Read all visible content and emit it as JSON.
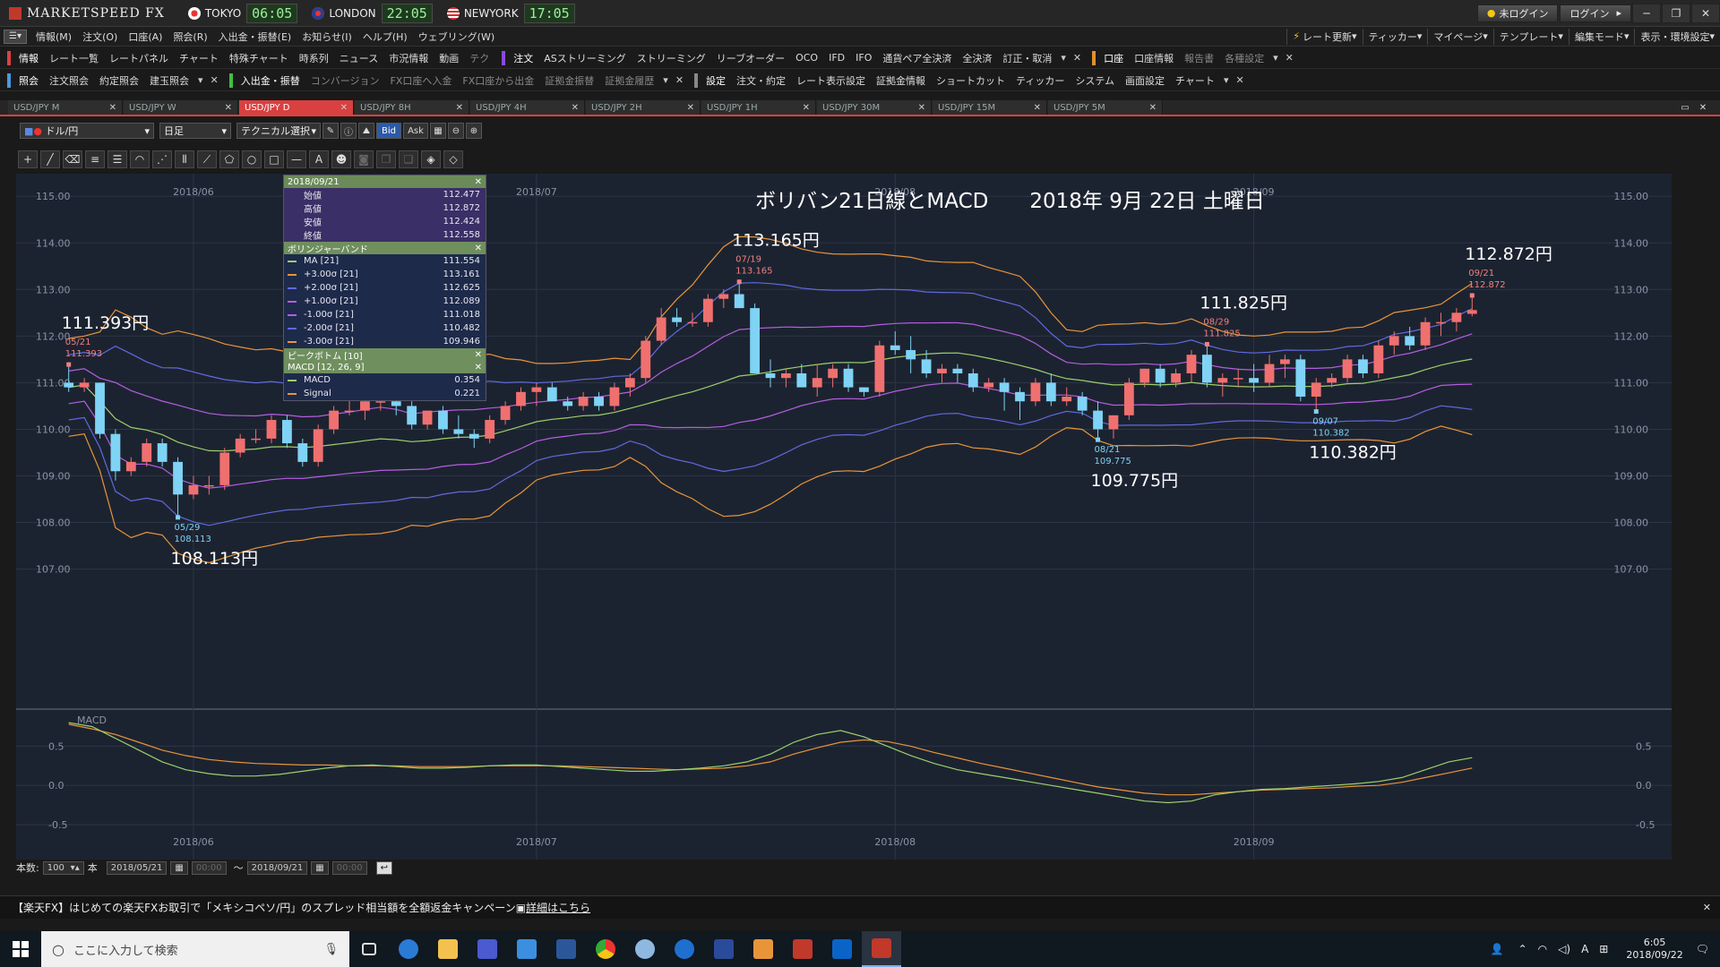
{
  "titlebar": {
    "app_title": "MARKETSPEED FX",
    "clocks": [
      {
        "label": "TOKYO",
        "time": "06:05"
      },
      {
        "label": "LONDON",
        "time": "22:05"
      },
      {
        "label": "NEWYORK",
        "time": "17:05"
      }
    ],
    "login_status": "未ログイン",
    "login_button": "ログイン"
  },
  "menubar": {
    "items": [
      "情報(M)",
      "注文(O)",
      "口座(A)",
      "照会(R)",
      "入出金・振替(E)",
      "お知らせ(I)",
      "ヘルプ(H)",
      "ウェブリング(W)"
    ],
    "right_items": [
      "レート更新",
      "ティッカー",
      "マイページ",
      "テンプレート",
      "編集モード",
      "表示・環境設定"
    ]
  },
  "tools1": {
    "group1": [
      "情報",
      "レート一覧",
      "レートパネル",
      "チャート",
      "特殊チャート",
      "時系列",
      "ニュース",
      "市況情報",
      "動画",
      "テク"
    ],
    "group2": [
      "注文",
      "ASストリーミング",
      "ストリーミング",
      "リーブオーダー",
      "OCO",
      "IFD",
      "IFO",
      "通貨ペア全決済",
      "全決済",
      "訂正・取消"
    ],
    "group3": [
      "口座",
      "口座情報",
      "報告書",
      "各種設定"
    ]
  },
  "tools2": {
    "group1": [
      "照会",
      "注文照会",
      "約定照会",
      "建玉照会"
    ],
    "group2": [
      "入出金・振替",
      "コンバージョン",
      "FX口座へ入金",
      "FX口座から出金",
      "証拠金振替",
      "証拠金履歴"
    ],
    "group3": [
      "設定",
      "注文・約定",
      "レート表示設定",
      "証拠金情報",
      "ショートカット",
      "ティッカー",
      "システム",
      "画面設定",
      "チャート"
    ]
  },
  "tabs": [
    "USD/JPY M",
    "USD/JPY W",
    "USD/JPY D",
    "USD/JPY 8H",
    "USD/JPY 4H",
    "USD/JPY 2H",
    "USD/JPY 1H",
    "USD/JPY 30M",
    "USD/JPY 15M",
    "USD/JPY 5M"
  ],
  "active_tab": 2,
  "charttools": {
    "pair": "ドル/円",
    "period": "日足",
    "technical": "テクニカル選択",
    "bid": "Bid",
    "ask": "Ask"
  },
  "infopanel": {
    "date": "2018/09/21",
    "ohlc": [
      {
        "label": "始値",
        "value": "112.477"
      },
      {
        "label": "高値",
        "value": "112.872"
      },
      {
        "label": "安値",
        "value": "112.424"
      },
      {
        "label": "終値",
        "value": "112.558"
      }
    ],
    "bb_title": "ボリンジャーバンド",
    "bb": [
      {
        "label": "MA [21]",
        "value": "111.554",
        "color": "#9bd06c"
      },
      {
        "label": "+3.00σ [21]",
        "value": "113.161",
        "color": "#e8953a"
      },
      {
        "label": "+2.00σ [21]",
        "value": "112.625",
        "color": "#5f6ae0"
      },
      {
        "label": "+1.00σ [21]",
        "value": "112.089",
        "color": "#b45ee0"
      },
      {
        "label": "-1.00σ [21]",
        "value": "111.018",
        "color": "#b45ee0"
      },
      {
        "label": "-2.00σ [21]",
        "value": "110.482",
        "color": "#5f6ae0"
      },
      {
        "label": "-3.00σ [21]",
        "value": "109.946",
        "color": "#e8953a"
      }
    ],
    "peak_title": "ピークボトム [10]",
    "macd_title": "MACD [12, 26, 9]",
    "macd": [
      {
        "label": "MACD",
        "value": "0.354",
        "color": "#9bd06c"
      },
      {
        "label": "Signal",
        "value": "0.221",
        "color": "#e8953a"
      }
    ]
  },
  "chart_data": {
    "type": "candlestick",
    "title": "ボリバン21日線とMACD　　2018年 9月 22日 土曜日",
    "y_ticks": [
      "115.00",
      "114.00",
      "113.00",
      "112.00",
      "111.00",
      "110.00",
      "109.00",
      "108.00",
      "107.00"
    ],
    "ylim": [
      106.8,
      115.1
    ],
    "x_month_labels": [
      "2018/06",
      "2018/07",
      "2018/08",
      "2018/09"
    ],
    "colors": {
      "up": "#f07070",
      "down": "#7fd3f5",
      "ma": "#9bd06c",
      "s3": "#e8953a",
      "s2": "#5f6ae0",
      "s1": "#b45ee0",
      "macd": "#9bd06c",
      "signal": "#e8953a"
    },
    "candles": [
      [
        111.0,
        111.39,
        110.8,
        110.9
      ],
      [
        110.9,
        111.1,
        110.8,
        111.0
      ],
      [
        111.0,
        111.0,
        109.8,
        109.9
      ],
      [
        109.9,
        110.0,
        108.9,
        109.1
      ],
      [
        109.1,
        109.4,
        109.0,
        109.3
      ],
      [
        109.3,
        109.8,
        109.2,
        109.7
      ],
      [
        109.7,
        109.8,
        109.2,
        109.3
      ],
      [
        109.3,
        109.4,
        108.11,
        108.6
      ],
      [
        108.6,
        109.0,
        108.5,
        108.8
      ],
      [
        108.8,
        109.0,
        108.6,
        108.8
      ],
      [
        108.8,
        109.6,
        108.7,
        109.5
      ],
      [
        109.5,
        109.9,
        109.4,
        109.8
      ],
      [
        109.8,
        110.0,
        109.7,
        109.8
      ],
      [
        109.8,
        110.3,
        109.7,
        110.2
      ],
      [
        110.2,
        110.3,
        109.6,
        109.7
      ],
      [
        109.7,
        109.8,
        109.2,
        109.3
      ],
      [
        109.3,
        110.1,
        109.2,
        110.0
      ],
      [
        110.0,
        110.5,
        109.9,
        110.4
      ],
      [
        110.4,
        110.9,
        110.3,
        110.4
      ],
      [
        110.4,
        110.7,
        110.2,
        110.6
      ],
      [
        110.6,
        110.7,
        110.4,
        110.6
      ],
      [
        110.6,
        110.9,
        110.3,
        110.5
      ],
      [
        110.5,
        110.6,
        110.0,
        110.1
      ],
      [
        110.1,
        110.4,
        110.0,
        110.4
      ],
      [
        110.4,
        110.5,
        109.9,
        110.0
      ],
      [
        110.0,
        110.3,
        109.8,
        109.9
      ],
      [
        109.9,
        110.0,
        109.6,
        109.8
      ],
      [
        109.8,
        110.3,
        109.7,
        110.2
      ],
      [
        110.2,
        110.6,
        110.1,
        110.5
      ],
      [
        110.5,
        110.9,
        110.4,
        110.8
      ],
      [
        110.8,
        111.0,
        110.5,
        110.9
      ],
      [
        110.9,
        111.0,
        110.6,
        110.6
      ],
      [
        110.6,
        110.7,
        110.4,
        110.5
      ],
      [
        110.5,
        110.8,
        110.4,
        110.7
      ],
      [
        110.7,
        110.8,
        110.4,
        110.5
      ],
      [
        110.5,
        111.0,
        110.4,
        110.9
      ],
      [
        110.9,
        111.2,
        110.7,
        111.1
      ],
      [
        111.1,
        112.0,
        111.0,
        111.9
      ],
      [
        111.9,
        112.6,
        111.8,
        112.4
      ],
      [
        112.4,
        112.6,
        112.2,
        112.3
      ],
      [
        112.3,
        112.5,
        112.2,
        112.3
      ],
      [
        112.3,
        112.9,
        112.2,
        112.8
      ],
      [
        112.8,
        113.0,
        112.6,
        112.9
      ],
      [
        112.9,
        113.165,
        112.6,
        112.6
      ],
      [
        112.6,
        112.7,
        111.2,
        111.2
      ],
      [
        111.2,
        111.5,
        110.9,
        111.1
      ],
      [
        111.1,
        111.3,
        110.9,
        111.2
      ],
      [
        111.2,
        111.4,
        110.9,
        110.9
      ],
      [
        110.9,
        111.4,
        110.7,
        111.1
      ],
      [
        111.1,
        111.4,
        110.9,
        111.3
      ],
      [
        111.3,
        111.4,
        110.8,
        110.9
      ],
      [
        110.9,
        110.9,
        110.7,
        110.8
      ],
      [
        110.8,
        111.9,
        110.7,
        111.8
      ],
      [
        111.8,
        112.1,
        111.6,
        111.7
      ],
      [
        111.7,
        112.0,
        111.2,
        111.5
      ],
      [
        111.5,
        111.7,
        111.1,
        111.2
      ],
      [
        111.2,
        111.4,
        111.0,
        111.3
      ],
      [
        111.3,
        111.4,
        111.0,
        111.2
      ],
      [
        111.2,
        111.3,
        110.8,
        110.9
      ],
      [
        110.9,
        111.1,
        110.8,
        111.0
      ],
      [
        111.0,
        111.1,
        110.4,
        110.8
      ],
      [
        110.8,
        110.9,
        110.2,
        110.6
      ],
      [
        110.6,
        111.1,
        110.5,
        111.0
      ],
      [
        111.0,
        111.2,
        110.5,
        110.6
      ],
      [
        110.6,
        110.9,
        110.5,
        110.7
      ],
      [
        110.7,
        110.8,
        110.3,
        110.4
      ],
      [
        110.4,
        110.6,
        109.775,
        110.0
      ],
      [
        110.0,
        110.3,
        109.8,
        110.3
      ],
      [
        110.3,
        111.1,
        110.2,
        111.0
      ],
      [
        111.0,
        111.3,
        110.9,
        111.3
      ],
      [
        111.3,
        111.4,
        110.9,
        111.0
      ],
      [
        111.0,
        111.3,
        110.9,
        111.2
      ],
      [
        111.2,
        111.7,
        111.0,
        111.6
      ],
      [
        111.6,
        111.825,
        110.9,
        111.0
      ],
      [
        111.0,
        111.2,
        110.7,
        111.1
      ],
      [
        111.1,
        111.3,
        110.9,
        111.1
      ],
      [
        111.1,
        111.4,
        110.8,
        111.0
      ],
      [
        111.0,
        111.6,
        110.9,
        111.4
      ],
      [
        111.4,
        111.6,
        111.1,
        111.5
      ],
      [
        111.5,
        111.6,
        110.6,
        110.7
      ],
      [
        110.7,
        111.1,
        110.382,
        111.0
      ],
      [
        111.0,
        111.2,
        110.9,
        111.1
      ],
      [
        111.1,
        111.6,
        111.0,
        111.5
      ],
      [
        111.5,
        111.6,
        111.1,
        111.2
      ],
      [
        111.2,
        111.9,
        111.1,
        111.8
      ],
      [
        111.8,
        112.1,
        111.6,
        112.0
      ],
      [
        112.0,
        112.2,
        111.7,
        111.8
      ],
      [
        111.8,
        112.4,
        111.7,
        112.3
      ],
      [
        112.3,
        112.5,
        112.0,
        112.3
      ],
      [
        112.3,
        112.6,
        112.1,
        112.5
      ],
      [
        112.477,
        112.872,
        112.424,
        112.558
      ]
    ],
    "annotations": [
      {
        "idx": 0,
        "date": "05/21",
        "price": "111.393",
        "big": "111.393円",
        "pos": "high"
      },
      {
        "idx": 7,
        "date": "05/29",
        "price": "108.113",
        "big": "108.113円",
        "pos": "low"
      },
      {
        "idx": 43,
        "date": "07/19",
        "price": "113.165",
        "big": "113.165円",
        "pos": "high"
      },
      {
        "idx": 66,
        "date": "08/21",
        "price": "109.775",
        "big": "109.775円",
        "pos": "low"
      },
      {
        "idx": 73,
        "date": "08/29",
        "price": "111.825",
        "big": "111.825円",
        "pos": "high"
      },
      {
        "idx": 80,
        "date": "09/07",
        "price": "110.382",
        "big": "110.382円",
        "pos": "low"
      },
      {
        "idx": 90,
        "date": "09/21",
        "price": "112.872",
        "big": "112.872円",
        "pos": "high"
      }
    ],
    "macd_panel": {
      "label": "MACD",
      "y_ticks": [
        "0.5",
        "0.0",
        "-0.5"
      ],
      "ylim": [
        -0.9,
        0.95
      ],
      "macd_points": [
        0.8,
        0.75,
        0.6,
        0.45,
        0.3,
        0.2,
        0.15,
        0.12,
        0.12,
        0.14,
        0.18,
        0.22,
        0.25,
        0.26,
        0.24,
        0.22,
        0.22,
        0.23,
        0.25,
        0.26,
        0.26,
        0.24,
        0.22,
        0.2,
        0.18,
        0.18,
        0.2,
        0.22,
        0.25,
        0.3,
        0.4,
        0.55,
        0.65,
        0.7,
        0.62,
        0.5,
        0.38,
        0.28,
        0.2,
        0.15,
        0.1,
        0.05,
        0.0,
        -0.05,
        -0.1,
        -0.15,
        -0.2,
        -0.22,
        -0.2,
        -0.12,
        -0.08,
        -0.05,
        -0.04,
        -0.02,
        0.0,
        0.02,
        0.05,
        0.1,
        0.2,
        0.3,
        0.354
      ],
      "signal_points": [
        0.78,
        0.72,
        0.65,
        0.55,
        0.45,
        0.38,
        0.33,
        0.3,
        0.28,
        0.27,
        0.26,
        0.26,
        0.25,
        0.25,
        0.25,
        0.24,
        0.24,
        0.24,
        0.25,
        0.25,
        0.25,
        0.25,
        0.24,
        0.23,
        0.22,
        0.21,
        0.2,
        0.21,
        0.22,
        0.25,
        0.3,
        0.4,
        0.48,
        0.55,
        0.58,
        0.56,
        0.5,
        0.42,
        0.35,
        0.28,
        0.22,
        0.16,
        0.1,
        0.04,
        -0.02,
        -0.06,
        -0.1,
        -0.12,
        -0.12,
        -0.1,
        -0.08,
        -0.06,
        -0.05,
        -0.04,
        -0.03,
        -0.01,
        0.0,
        0.04,
        0.1,
        0.16,
        0.221
      ]
    }
  },
  "bottombar": {
    "count_label": "本数:",
    "count": "100",
    "unit": "本",
    "from_date": "2018/05/21",
    "from_time": "00:00",
    "tilde": "〜",
    "to_date": "2018/09/21",
    "to_time": "00:00"
  },
  "ticker": {
    "text": "【楽天FX】はじめての楽天FXお取引で「メキシコペソ/円」のスプレッド相当額を全額返金キャンペーン",
    "link": "詳細はこちら"
  },
  "taskbar": {
    "search_placeholder": "ここに入力して検索",
    "time": "6:05",
    "date": "2018/09/22",
    "ime": "A"
  }
}
